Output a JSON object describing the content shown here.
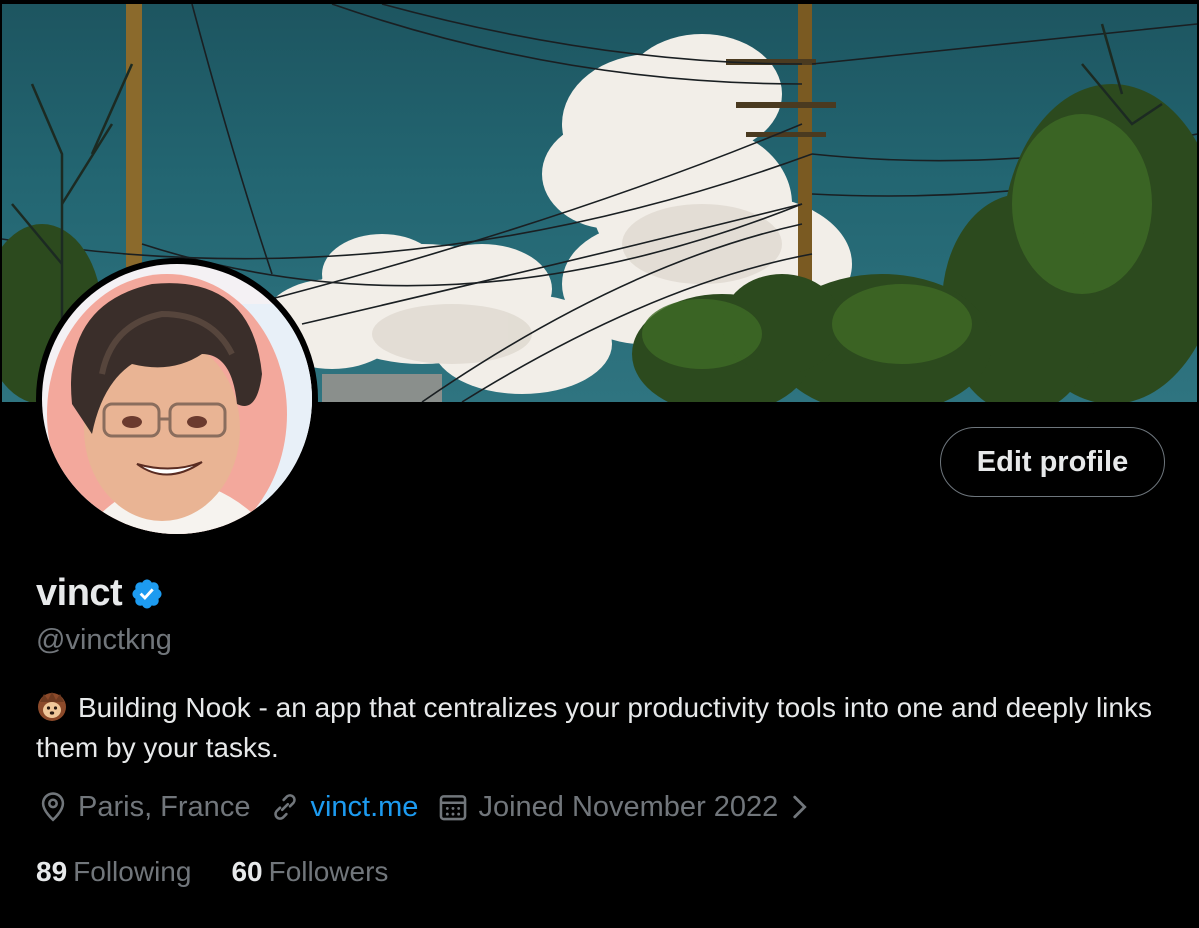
{
  "profile": {
    "display_name": "vinct",
    "verified": true,
    "handle": "@vinctkng",
    "bio_emoji": "hedgehog-emoji",
    "bio": "Building Nook - an app that centralizes your productivity tools into one and deeply links them by your tasks.",
    "location": "Paris, France",
    "website": "vinct.me",
    "joined": "Joined November 2022",
    "following_count": "89",
    "following_label": "Following",
    "followers_count": "60",
    "followers_label": "Followers"
  },
  "actions": {
    "edit_profile_label": "Edit profile"
  },
  "icons": {
    "verified": "verified-badge-icon",
    "location": "location-pin-icon",
    "link": "link-icon",
    "calendar": "calendar-icon",
    "chevron": "chevron-right-icon"
  },
  "colors": {
    "background": "#000000",
    "primary_text": "#e7e9ea",
    "secondary_text": "#71767b",
    "link": "#1d9bf0",
    "verified": "#1d9bf0"
  }
}
